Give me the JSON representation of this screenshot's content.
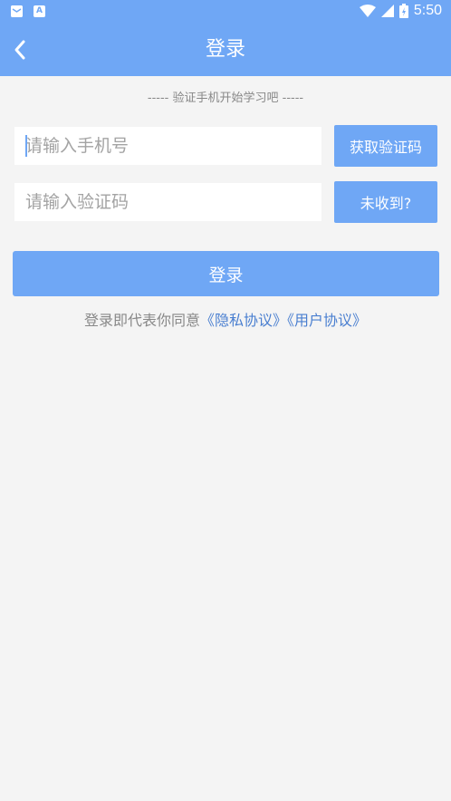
{
  "status_bar": {
    "time": "5:50",
    "left_icons": [
      "mail-icon",
      "a-icon"
    ],
    "left_icon_text": "A",
    "right_icons": [
      "wifi-icon",
      "signal-icon",
      "battery-icon"
    ]
  },
  "header": {
    "title": "登录",
    "back_icon": "chevron-left-icon"
  },
  "form": {
    "subtitle": "----- 验证手机开始学习吧 -----",
    "phone_placeholder": "请输入手机号",
    "code_placeholder": "请输入验证码",
    "get_code_label": "获取验证码",
    "not_received_label": "未收到?",
    "login_label": "登录"
  },
  "agreement": {
    "prefix": "登录即代表你同意",
    "privacy_link": "《隐私协议》",
    "user_link": "《用户协议》"
  },
  "colors": {
    "primary": "#6fa7f5",
    "background": "#f4f4f4",
    "link": "#4a7fd0",
    "muted_text": "#888888"
  }
}
